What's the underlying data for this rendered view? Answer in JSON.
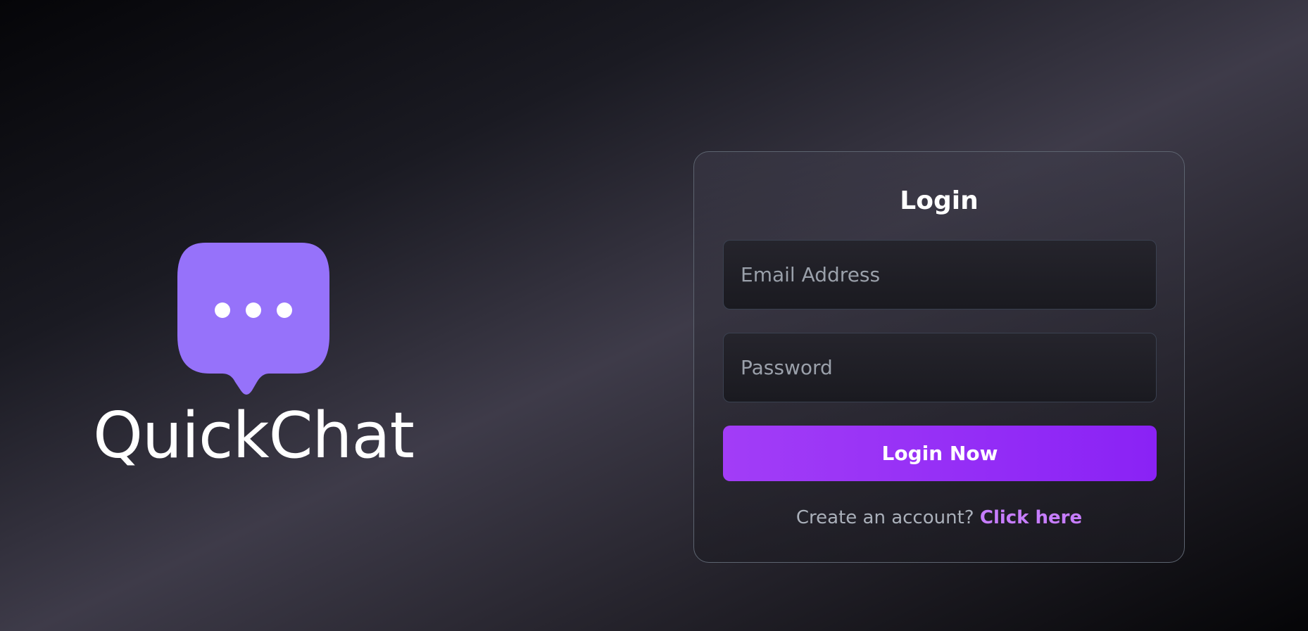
{
  "brand": {
    "name": "QuickChat",
    "logo_icon": "chat-bubble-icon",
    "logo_color": "#9672fa"
  },
  "login": {
    "title": "Login",
    "email_placeholder": "Email Address",
    "email_value": "",
    "password_placeholder": "Password",
    "password_value": "",
    "submit_label": "Login Now",
    "signup_prompt": "Create an account?",
    "signup_link": "Click here"
  },
  "colors": {
    "accent_start": "#a23df7",
    "accent_end": "#8a22f5",
    "link": "#c77dff"
  }
}
